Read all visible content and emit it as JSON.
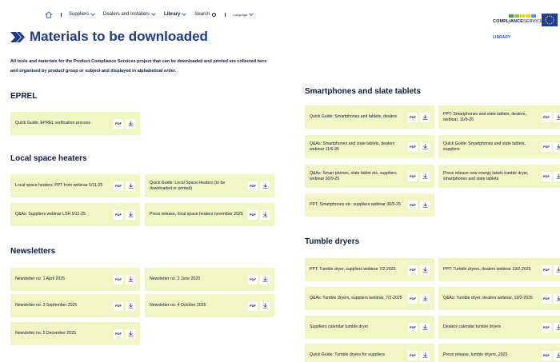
{
  "nav": {
    "items": [
      {
        "label": "Suppliers",
        "active": false
      },
      {
        "label": "Dealers and Installers",
        "active": false
      },
      {
        "label": "Library",
        "active": true
      }
    ],
    "search_label": "Search",
    "language_label": "Language"
  },
  "logo": {
    "brand_bold": "COMPLIANCE",
    "brand_light": "SERVICES",
    "dot_colors": [
      "#3fa535",
      "#8cc63f",
      "#d9e021",
      "#f7d117",
      "#4aa0d8"
    ]
  },
  "breadcrumb": "LIBRARY",
  "page": {
    "title": "Materials to be downloaded",
    "intro": "All tools and materials for the Product Compliance Services project that can be downloaded and printed are collected here and organised by product group or subject and displayed in alphabetical order."
  },
  "download": {
    "pdf_label": "PDF",
    "icon": "download-icon"
  },
  "sections": {
    "eprel": {
      "title": "EPREL",
      "items": [
        "Quick Guide: EPREL verification process"
      ]
    },
    "heaters": {
      "title": "Local space heaters",
      "items": [
        "Local space heaters, PPT from webinar 5/11-25",
        "Quick Guide: Local Space Heaters (to be downloaded or printed)",
        "Q&As: Suppliers webinar LSH 5/11-25",
        "Press release, local space heaters november 2025"
      ]
    },
    "newsletters": {
      "title": "Newsletters",
      "items": [
        "Newsletter no. 1 April 2025",
        "Newsletter no. 2 June 2025",
        "Newsletter no. 3 September 2025",
        "Newsletter no. 4 October 2025",
        "Newsletter no. 5 December 2025"
      ]
    },
    "smartphones": {
      "title": "Smartphones and slate tablets",
      "items": [
        "Quick Guide: Smartphones and tablets, dealers",
        "PPT: Smartphones and slate tablets, dealers, webinar, 11/6-25",
        "Q&As: Smartphones and slate tablets, dealers webinar 11/6-25",
        "Quick Guide: Smartphones and slate tablets, suppliers",
        "Q&As: Smart phones, slate tablet etc. suppliers webinar 30/9-25",
        "Press release new energy labels tumble dryer, smartphones and slate tablets",
        "PPT: Smartphones etc. suppliers webinar 30/9-25"
      ]
    },
    "dryers": {
      "title": "Tumble dryers",
      "items": [
        "PPT: Tumble dryer, suppliers webinar 7/2-2025",
        "PPT: Tumble dryers, dealers webinar 19/2-2025",
        "Q&As: Tumble dryers, suppliers webinar, 7/2-2025",
        "Q&As: Tumble dryer, dealers webinar, 19/2-2025",
        "Suppliers calendar tumble dryer",
        "Dealers calendar tumble dryers",
        "Quick Guide: Tumble dryers for suppliers",
        "Press release, tumble dryers, 2025"
      ]
    }
  }
}
